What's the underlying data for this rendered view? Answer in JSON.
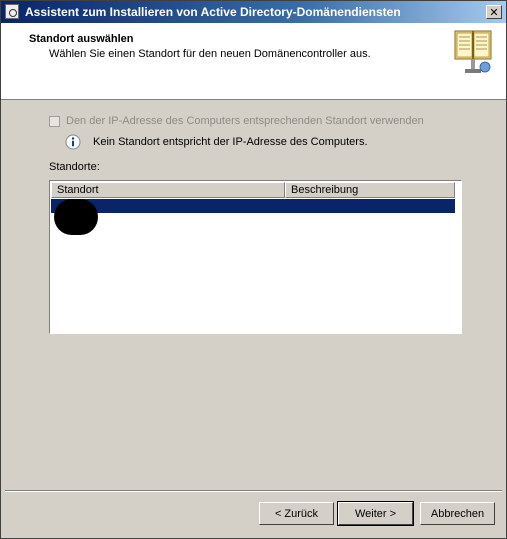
{
  "window": {
    "title": "Assistent zum Installieren von Active Directory-Domänendiensten",
    "close_label": "✕"
  },
  "header": {
    "title": "Standort auswählen",
    "subtitle": "Wählen Sie einen Standort für den neuen Domänencontroller aus."
  },
  "content": {
    "checkbox_label": "Den der IP-Adresse des Computers entsprechenden Standort verwenden",
    "info_text": "Kein Standort entspricht der IP-Adresse des Computers.",
    "sites_label": "Standorte:",
    "columns": [
      "Standort",
      "Beschreibung"
    ],
    "rows": [
      {
        "site": "",
        "description": "",
        "selected": true,
        "redacted": true
      }
    ]
  },
  "buttons": {
    "back": "< Zurück",
    "next": "Weiter >",
    "cancel": "Abbrechen"
  },
  "icons": {
    "window": "wizard-window-icon",
    "header": "book-icon",
    "info": "info-icon"
  },
  "colors": {
    "titlebar_start": "#0a246a",
    "titlebar_end": "#a6caf0",
    "selection": "#0a246a",
    "dialog_face": "#d4d0c8"
  }
}
